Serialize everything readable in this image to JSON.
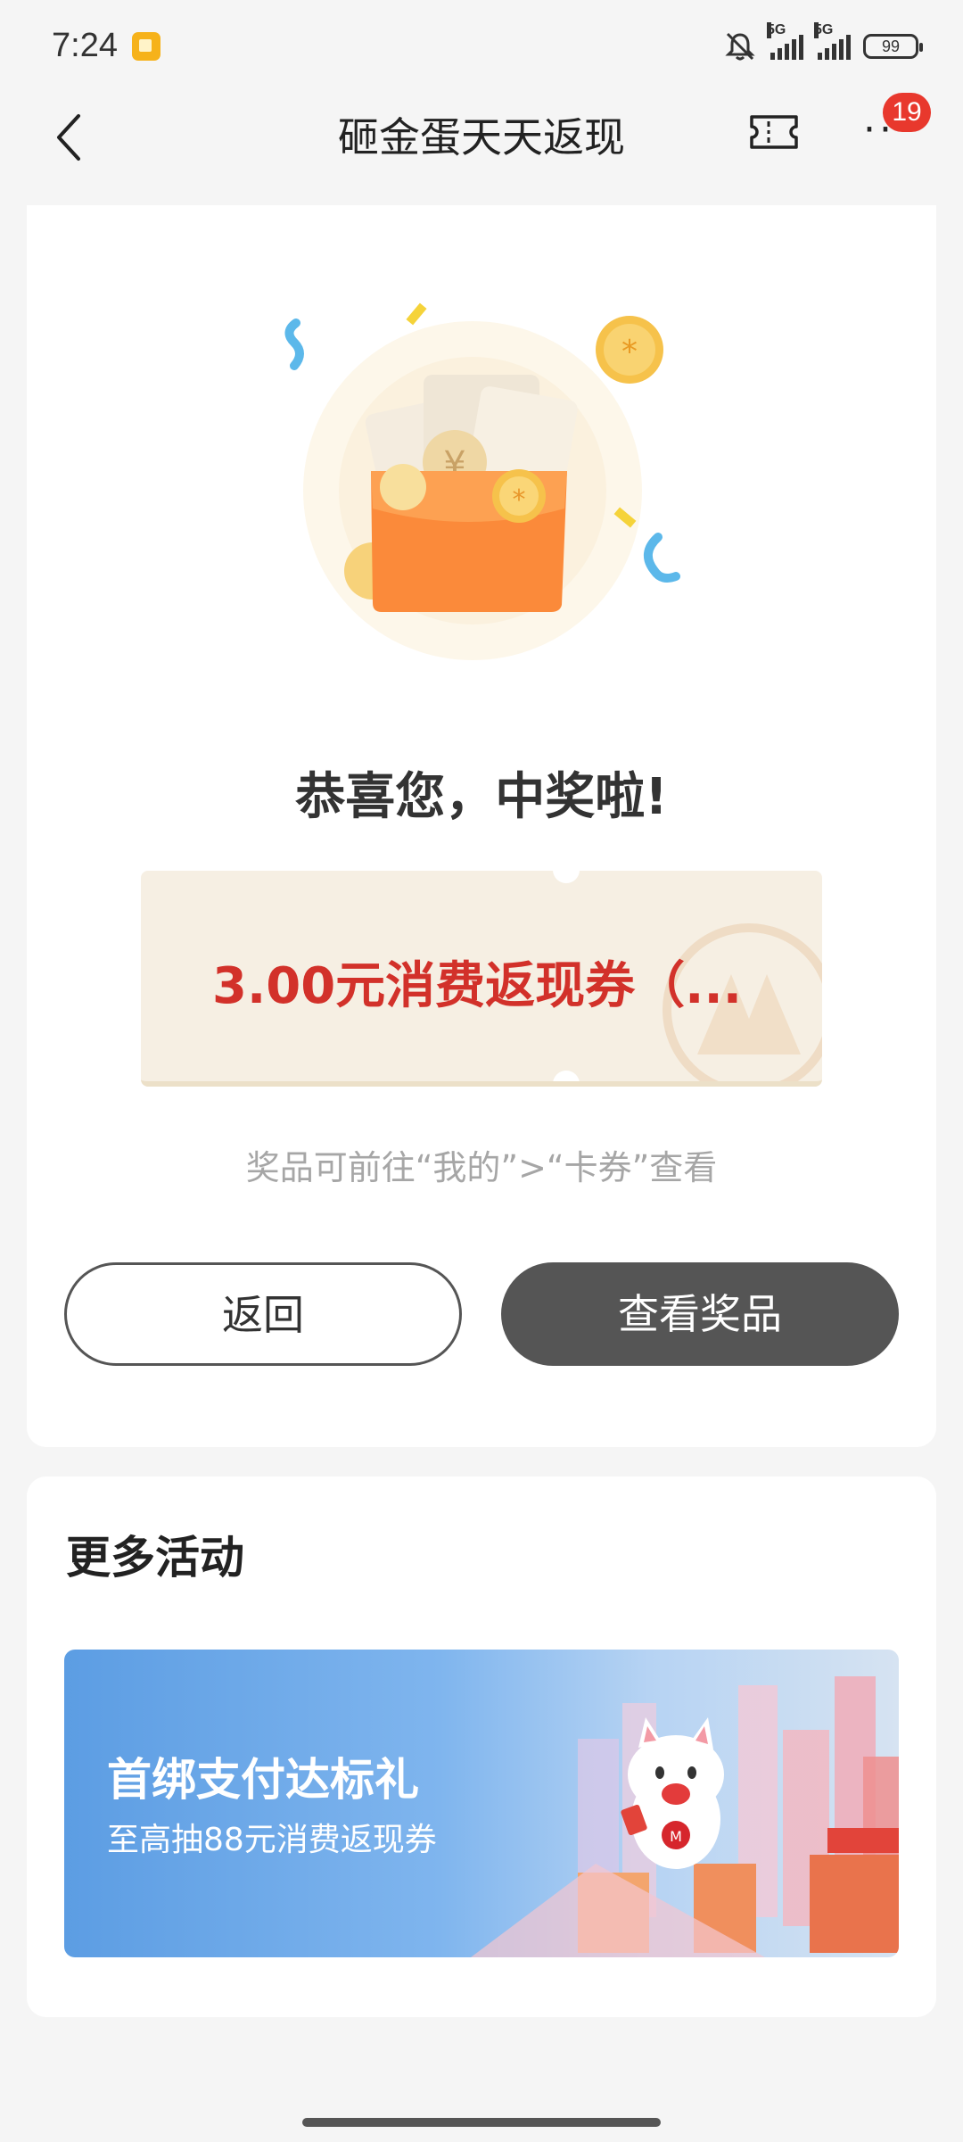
{
  "status_bar": {
    "time": "7:24",
    "network_1": "5G",
    "network_2": "5G",
    "battery": "99"
  },
  "nav": {
    "title": "砸金蛋天天返现",
    "badge_count": "19"
  },
  "result": {
    "title": "恭喜您，中奖啦!",
    "coupon_text": "3.00元消费返现券（...",
    "hint": "奖品可前往“我的”>“卡券”查看",
    "back_button": "返回",
    "view_button": "查看奖品"
  },
  "more": {
    "section_title": "更多活动",
    "banner": {
      "title": "首绑支付达标礼",
      "subtitle": "至高抽88元消费返现券"
    }
  },
  "colors": {
    "accent_red": "#d2312a",
    "badge_red": "#e8382d",
    "button_dark": "#555555",
    "coupon_bg": "#f6efe3",
    "banner_blue": "#5c9de3"
  }
}
